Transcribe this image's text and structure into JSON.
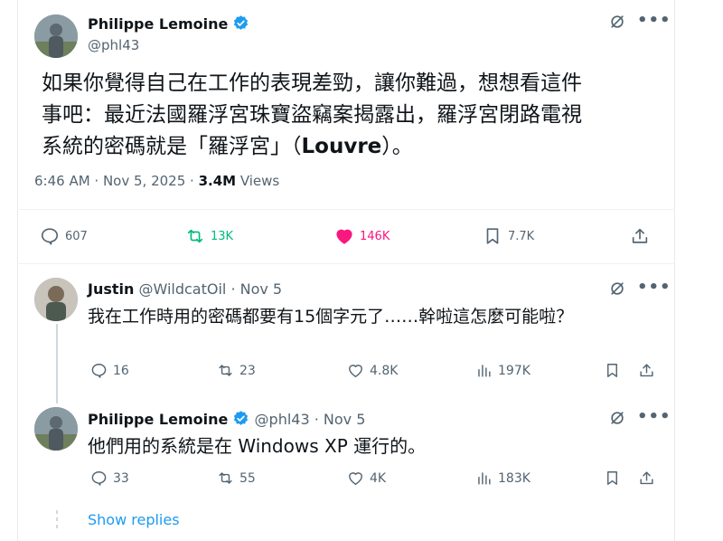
{
  "colors": {
    "accent": "#1d9bf0",
    "retweet": "#00ba7c",
    "like": "#f91880",
    "muted": "#536471"
  },
  "main_tweet": {
    "author_name": "Philippe Lemoine",
    "author_handle": "@phl43",
    "text_lines": [
      "如果你覺得自己在工作的表現差勁，讓你難過，想想看這件",
      "事吧：最近法國羅浮宮珠寶盜竊案揭露出，羅浮宮閉路電視",
      "系統的密碼就是「羅浮宮」（"
    ],
    "text_bold": "Louvre",
    "text_end": "）。",
    "timestamp": "6:46 AM · Nov 5, 2025 · ",
    "views_count": "3.4M",
    "views_label": " Views",
    "stats": {
      "replies": "607",
      "retweets": "13K",
      "likes": "146K",
      "bookmarks": "7.7K"
    }
  },
  "replies": [
    {
      "author_name": "Justin",
      "author_meta": "@WildcatOil · Nov 5",
      "text": "我在工作時用的密碼都要有15個字元了……幹啦這怎麼可能啦？",
      "stats": {
        "replies": "16",
        "retweets": "23",
        "likes": "4.8K",
        "views": "197K"
      }
    },
    {
      "author_name": "Philippe Lemoine",
      "author_meta": "@phl43 · Nov 5",
      "text": "他們用的系統是在 Windows XP 運行的。",
      "stats": {
        "replies": "33",
        "retweets": "55",
        "likes": "4K",
        "views": "183K"
      }
    }
  ],
  "show_replies_label": "Show replies"
}
